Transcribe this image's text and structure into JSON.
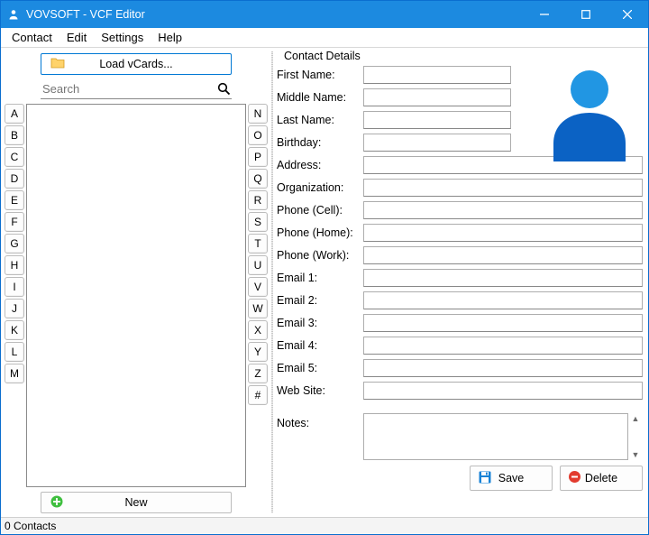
{
  "titlebar": {
    "title": "VOVSOFT - VCF Editor"
  },
  "menu": {
    "contact": "Contact",
    "edit": "Edit",
    "settings": "Settings",
    "help": "Help"
  },
  "left": {
    "load_label": "Load vCards...",
    "search_placeholder": "Search",
    "new_label": "New",
    "letters_left": [
      "A",
      "B",
      "C",
      "D",
      "E",
      "F",
      "G",
      "H",
      "I",
      "J",
      "K",
      "L",
      "M"
    ],
    "letters_right": [
      "N",
      "O",
      "P",
      "Q",
      "R",
      "S",
      "T",
      "U",
      "V",
      "W",
      "X",
      "Y",
      "Z",
      "#"
    ]
  },
  "details": {
    "legend": "Contact Details",
    "labels": {
      "first_name": "First Name:",
      "middle_name": "Middle Name:",
      "last_name": "Last Name:",
      "birthday": "Birthday:",
      "address": "Address:",
      "organization": "Organization:",
      "phone_cell": "Phone (Cell):",
      "phone_home": "Phone (Home):",
      "phone_work": "Phone (Work):",
      "email1": "Email 1:",
      "email2": "Email 2:",
      "email3": "Email 3:",
      "email4": "Email 4:",
      "email5": "Email 5:",
      "website": "Web Site:",
      "notes": "Notes:"
    },
    "values": {
      "first_name": "",
      "middle_name": "",
      "last_name": "",
      "birthday": "",
      "address": "",
      "organization": "",
      "phone_cell": "",
      "phone_home": "",
      "phone_work": "",
      "email1": "",
      "email2": "",
      "email3": "",
      "email4": "",
      "email5": "",
      "website": "",
      "notes": ""
    },
    "save_label": "Save",
    "delete_label": "Delete"
  },
  "status": {
    "text": "0 Contacts"
  }
}
